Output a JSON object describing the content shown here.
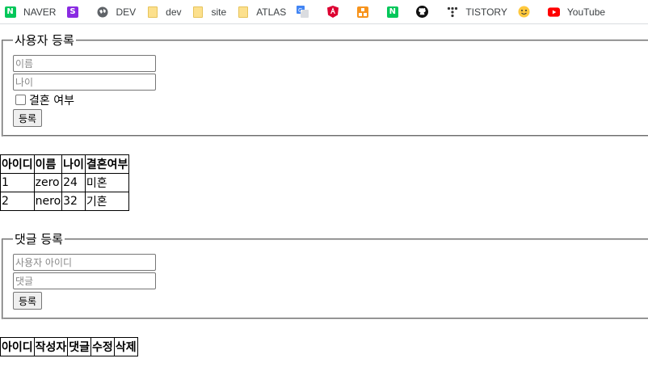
{
  "bookmarks": [
    {
      "label": "NAVER",
      "icon": "naver-icon"
    },
    {
      "label": "",
      "icon": "stack-icon"
    },
    {
      "label": "DEV",
      "icon": "globe-icon"
    },
    {
      "label": "dev",
      "icon": "folder-icon"
    },
    {
      "label": "site",
      "icon": "folder-icon"
    },
    {
      "label": "ATLAS",
      "icon": "folder-icon"
    },
    {
      "label": "",
      "icon": "translate-icon"
    },
    {
      "label": "",
      "icon": "angular-icon"
    },
    {
      "label": "",
      "icon": "nodes-icon"
    },
    {
      "label": "",
      "icon": "naver-icon"
    },
    {
      "label": "",
      "icon": "github-icon"
    },
    {
      "label": "TISTORY",
      "icon": "tistory-icon"
    },
    {
      "label": "",
      "icon": "smiley-icon"
    },
    {
      "label": "YouTube",
      "icon": "youtube-icon"
    }
  ],
  "user_form": {
    "legend": "사용자 등록",
    "name_placeholder": "이름",
    "age_placeholder": "나이",
    "married_label": "결혼 여부",
    "submit_label": "등록"
  },
  "user_table": {
    "headers": [
      "아이디",
      "이름",
      "나이",
      "결혼여부"
    ],
    "rows": [
      [
        "1",
        "zero",
        "24",
        "미혼"
      ],
      [
        "2",
        "nero",
        "32",
        "기혼"
      ]
    ]
  },
  "comment_form": {
    "legend": "댓글 등록",
    "userid_placeholder": "사용자 아이디",
    "comment_placeholder": "댓글",
    "submit_label": "등록"
  },
  "comment_table": {
    "headers": [
      "아이디",
      "작성자",
      "댓글",
      "수정",
      "삭제"
    ]
  }
}
